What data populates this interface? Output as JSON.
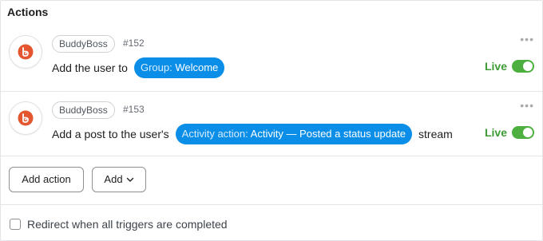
{
  "panel": {
    "title": "Actions"
  },
  "actions": [
    {
      "integration": "BuddyBoss",
      "id": "#152",
      "text_before": "Add the user to",
      "token_name": "Group:",
      "token_value": "Welcome",
      "text_after": "",
      "status": "Live"
    },
    {
      "integration": "BuddyBoss",
      "id": "#153",
      "text_before": "Add a post to the user's",
      "token_name": "Activity action:",
      "token_value": "Activity — Posted a status update",
      "text_after": "stream",
      "status": "Live"
    }
  ],
  "buttons": {
    "add_action": "Add action",
    "add": "Add"
  },
  "redirect": {
    "label": "Redirect when all triggers are completed",
    "checked": false
  },
  "colors": {
    "token": "#0a8ee8",
    "live": "#3d9b34",
    "toggle": "#4caf3f",
    "brand": "#e3562f"
  },
  "icons": {
    "integration": "buddyboss-logo-icon",
    "menu": "more-horizontal-icon",
    "dropdown": "chevron-down-icon"
  }
}
